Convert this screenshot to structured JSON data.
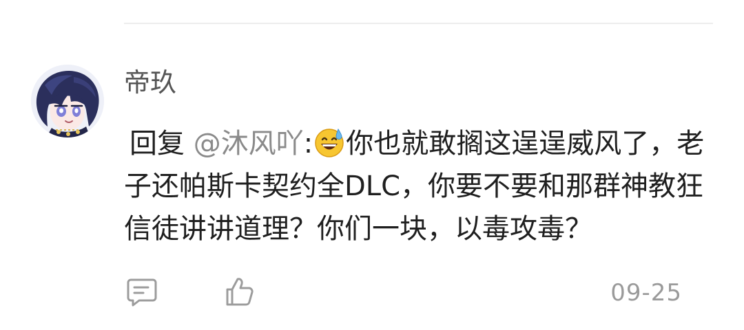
{
  "comment": {
    "author": "帝玖",
    "reply_prefix": "回复",
    "mention": "@沐风吖",
    "colon": ":",
    "emoji": "grinning-sweat-emoji",
    "text": "你也就敢搁这逞逞威风了，老子还帕斯卡契约全DLC，你要不要和那群神教狂信徒讲讲道理？你们一块，以毒攻毒？",
    "date": "09-25"
  },
  "actions": {
    "reply_icon": "comment-icon",
    "like_icon": "thumbs-up-icon"
  },
  "colors": {
    "text": "#1f1f1f",
    "mention": "#8a8a8a",
    "author": "#555555",
    "meta": "#9a9a9a",
    "divider": "#ededed"
  }
}
